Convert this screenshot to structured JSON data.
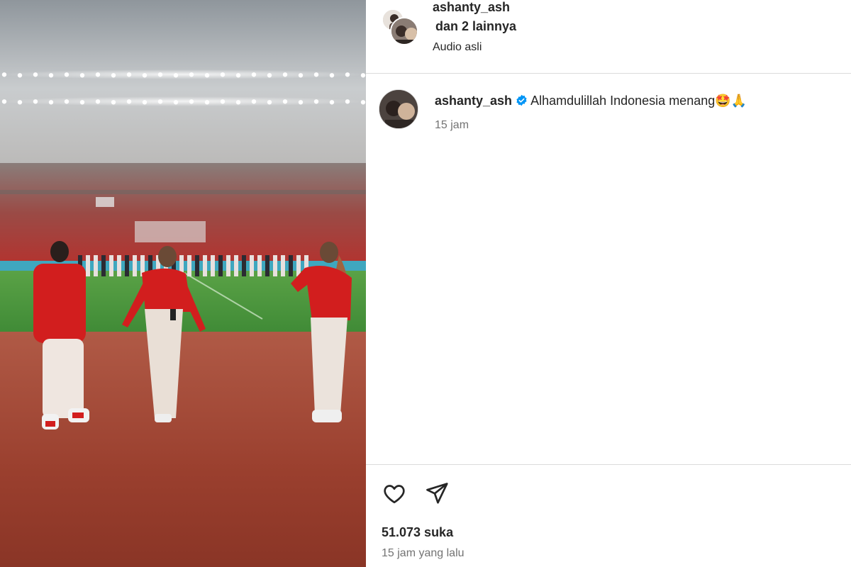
{
  "header": {
    "username": "ashanty_ash",
    "others": "dan 2 lainnya",
    "audio": "Audio asli"
  },
  "caption": {
    "username": "ashanty_ash",
    "text": "Alhamdulillah Indonesia menang🤩🙏",
    "time": "15 jam"
  },
  "footer": {
    "likes": "51.073 suka",
    "posted": "15 jam yang lalu"
  },
  "icons": {
    "like": "heart-outline-icon",
    "share": "paper-plane-icon",
    "verified": "verified-badge-icon"
  },
  "colors": {
    "verified": "#0095f6",
    "divider": "#dbdbdb",
    "secondary_text": "#737373",
    "jersey_red": "#d21e1e",
    "track": "#9a3f2e",
    "pitch": "#3f8a36"
  }
}
